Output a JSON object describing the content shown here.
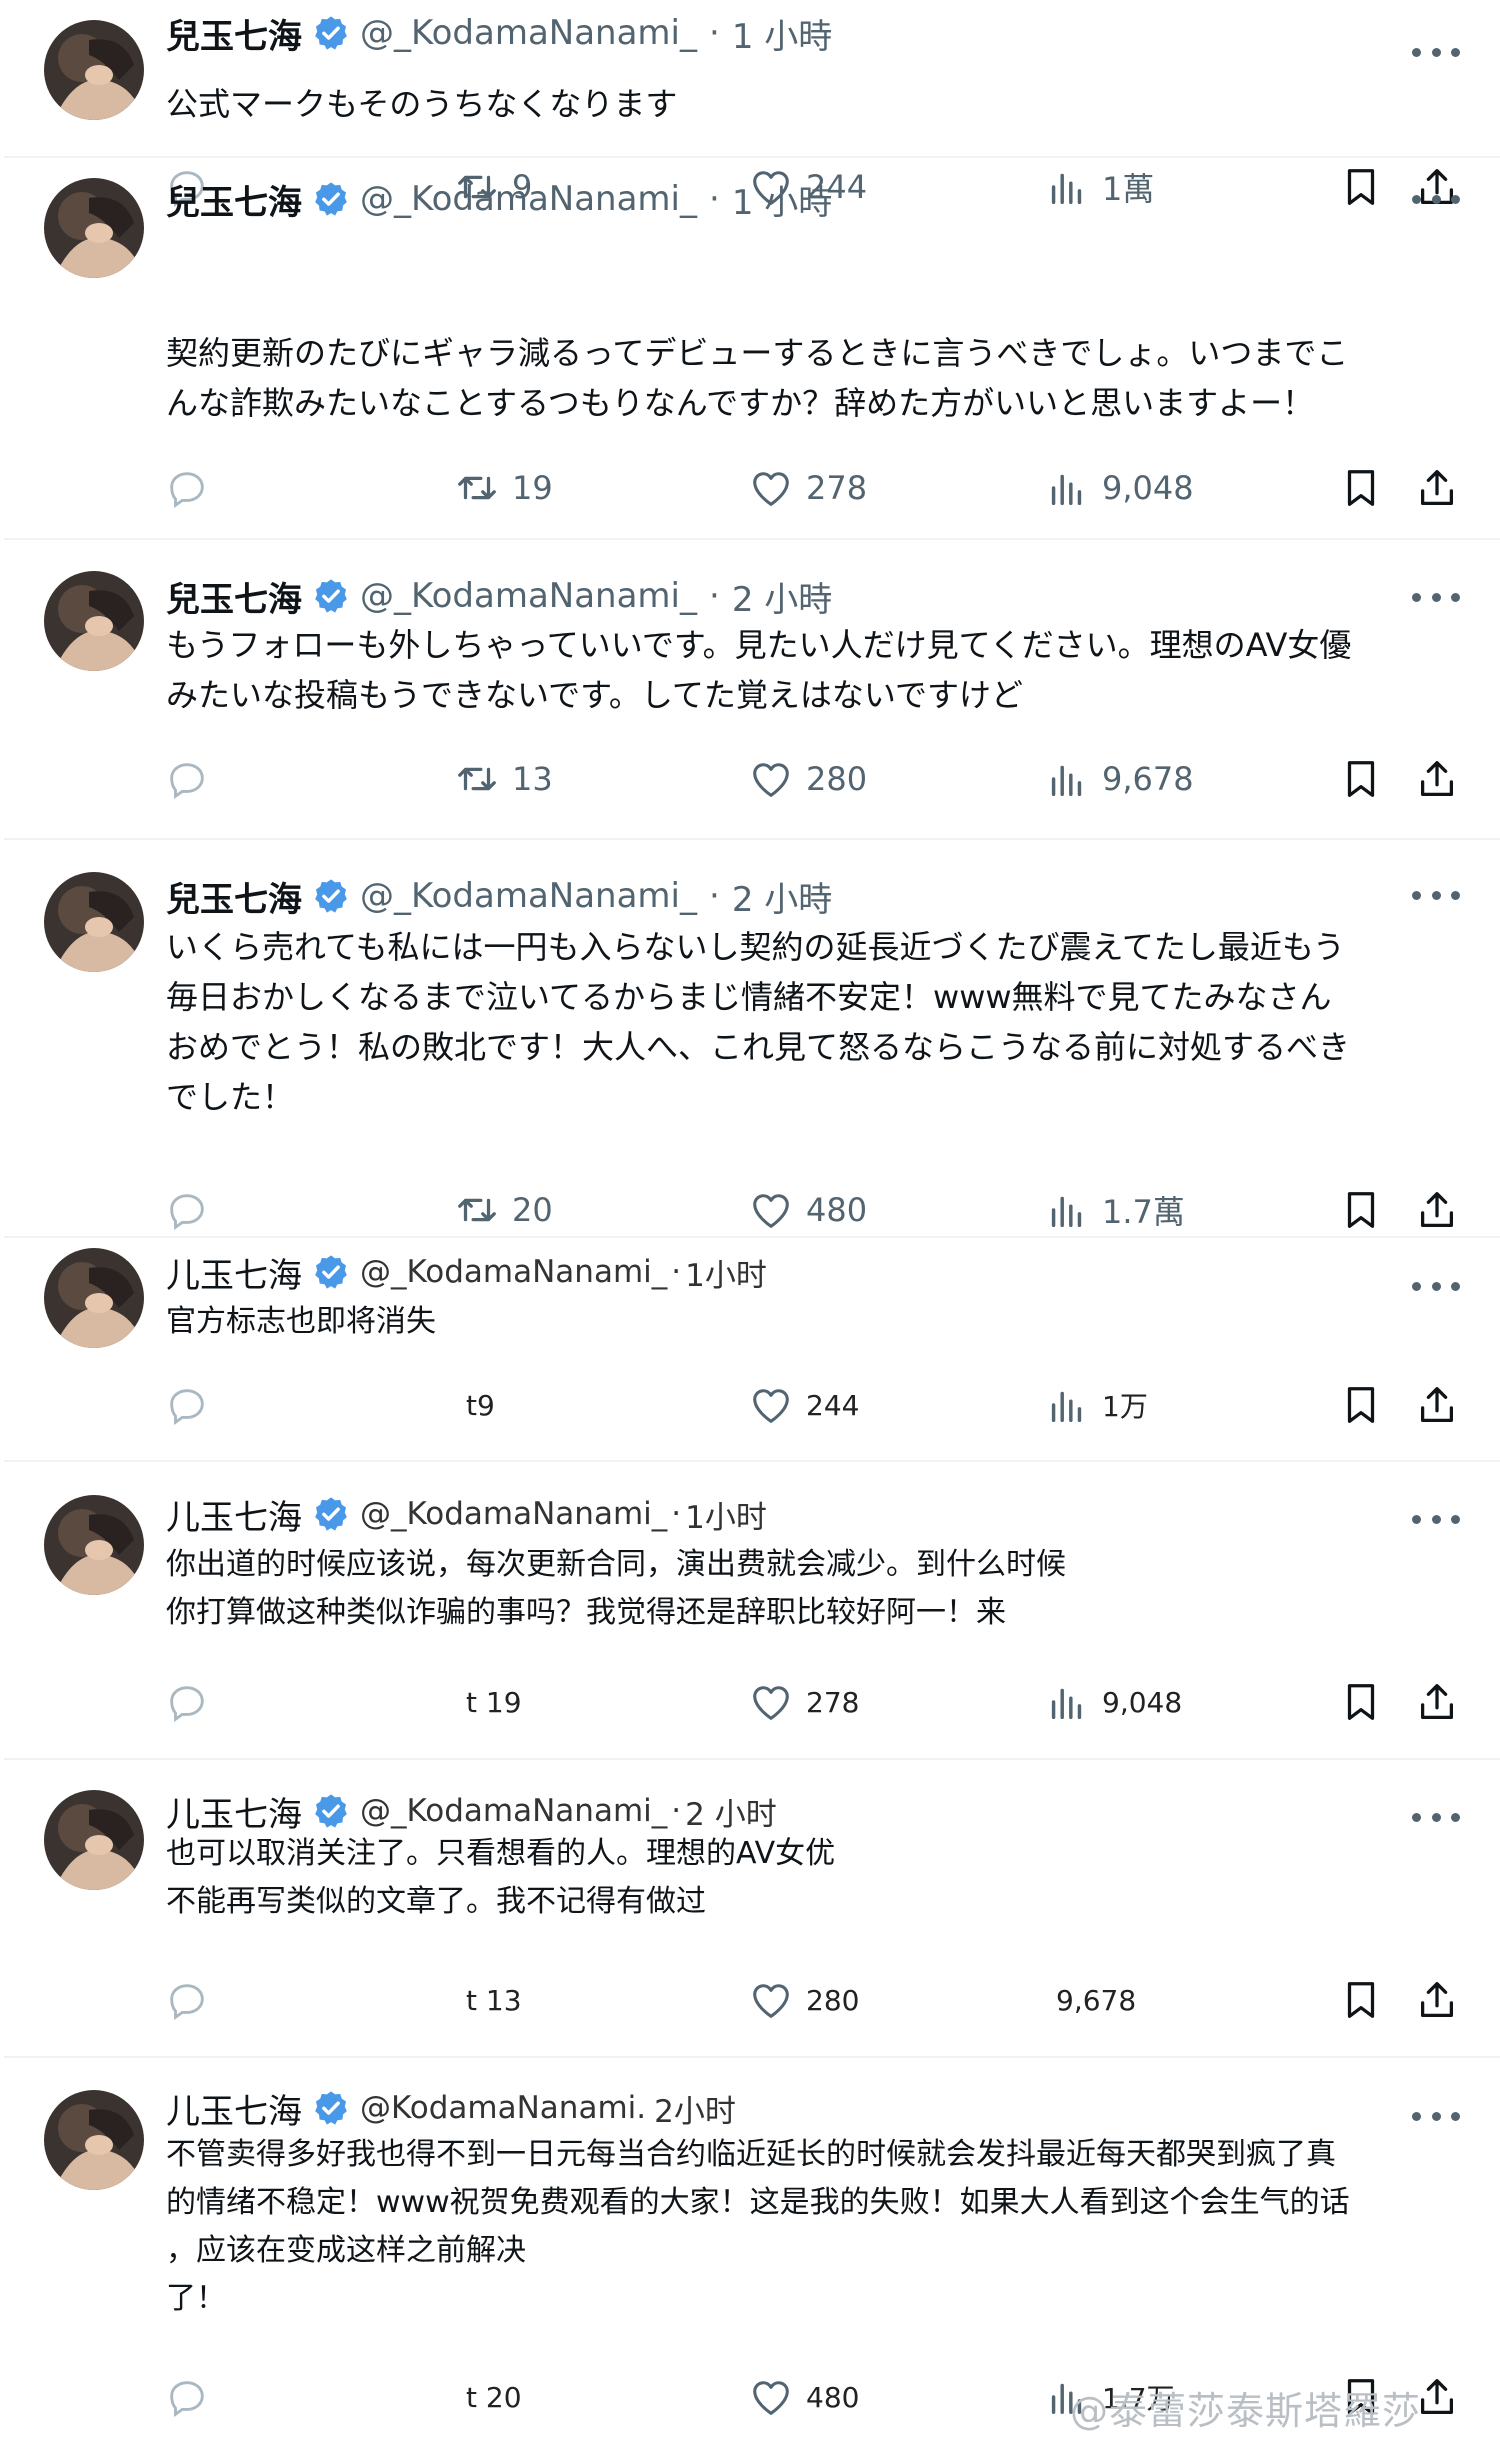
{
  "colors": {
    "badge": "#4a99e9",
    "text": "#0f1419",
    "muted": "#536471",
    "divider": "#eff3f4"
  },
  "icons": {
    "reply": "reply-icon",
    "retweet": "retweet-icon",
    "like": "heart-icon",
    "views": "views-icon",
    "bookmark": "bookmark-icon",
    "share": "share-icon",
    "verified": "verified-badge-icon",
    "more": "more-icon"
  },
  "tweets": [
    {
      "name": "兒玉七海",
      "handle": "@_KodamaNanami_",
      "sep": "·",
      "time": "1 小時",
      "text": "公式マークもそのうちなくなります",
      "retweets": "9",
      "likes": "244",
      "views": "1萬"
    },
    {
      "name": "兒玉七海",
      "handle": "@_KodamaNanami_",
      "sep": "·",
      "time": "1 小時",
      "text": "契約更新のたびにギャラ減るってデビューするときに言うべきでしょ。いつまでこ\nんな詐欺みたいなことするつもりなんですか？辞めた方がいいと思いますよー！",
      "retweets": "19",
      "likes": "278",
      "views": "9,048"
    },
    {
      "name": "兒玉七海",
      "handle": "@_KodamaNanami_",
      "sep": "·",
      "time": "2 小時",
      "text": "もうフォローも外しちゃっていいです。見たい人だけ見てください。理想のAV女優\nみたいな投稿もうできないです。してた覚えはないですけど",
      "retweets": "13",
      "likes": "280",
      "views": "9,678"
    },
    {
      "name": "兒玉七海",
      "handle": "@_KodamaNanami_",
      "sep": "·",
      "time": "2 小時",
      "text": "いくら売れても私には一円も入らないし契約の延長近づくたび震えてたし最近もう\n毎日おかしくなるまで泣いてるからまじ情緒不安定！www無料で見てたみなさん\nおめでとう！私の敗北です！大人へ、これ見て怒るならこうなる前に対処するべき\nでした！",
      "retweets": "20",
      "likes": "480",
      "views": "1.7萬"
    },
    {
      "name": "儿玉七海",
      "handle": "@_KodamaNanami_",
      "sep": "·",
      "time": "1小时",
      "text": "官方标志也即将消失",
      "retweets": "t9",
      "likes": "244",
      "views": "1万"
    },
    {
      "name": "儿玉七海",
      "handle": "@_KodamaNanami_",
      "sep": "·",
      "time": "1小时",
      "text": "你出道的时候应该说，每次更新合同，演出费就会减少。到什么时候\n你打算做这种类似诈骗的事吗？我觉得还是辞职比较好阿一！来",
      "retweets": "t 19",
      "likes": "278",
      "views": "9,048"
    },
    {
      "name": "儿玉七海",
      "handle": "@_KodamaNanami_",
      "sep": "·",
      "time": "2 小时",
      "text": "也可以取消关注了。只看想看的人。理想的AV女优\n不能再写类似的文章了。我不记得有做过",
      "retweets": "t 13",
      "likes": "280",
      "views": "9,678"
    },
    {
      "name": "儿玉七海",
      "handle": "@KodamaNanami.",
      "sep": "",
      "time": "2小时",
      "text": "不管卖得多好我也得不到一日元每当合约临近延长的时候就会发抖最近每天都哭到疯了真\n的情绪不稳定！www祝贺免费观看的大家！这是我的失败！如果大人看到这个会生气的话\n，应该在变成这样之前解决\n了！",
      "retweets": "t 20",
      "likes": "480",
      "views": "1.7万"
    }
  ],
  "watermark": "@泰蕾莎泰斯塔羅莎"
}
